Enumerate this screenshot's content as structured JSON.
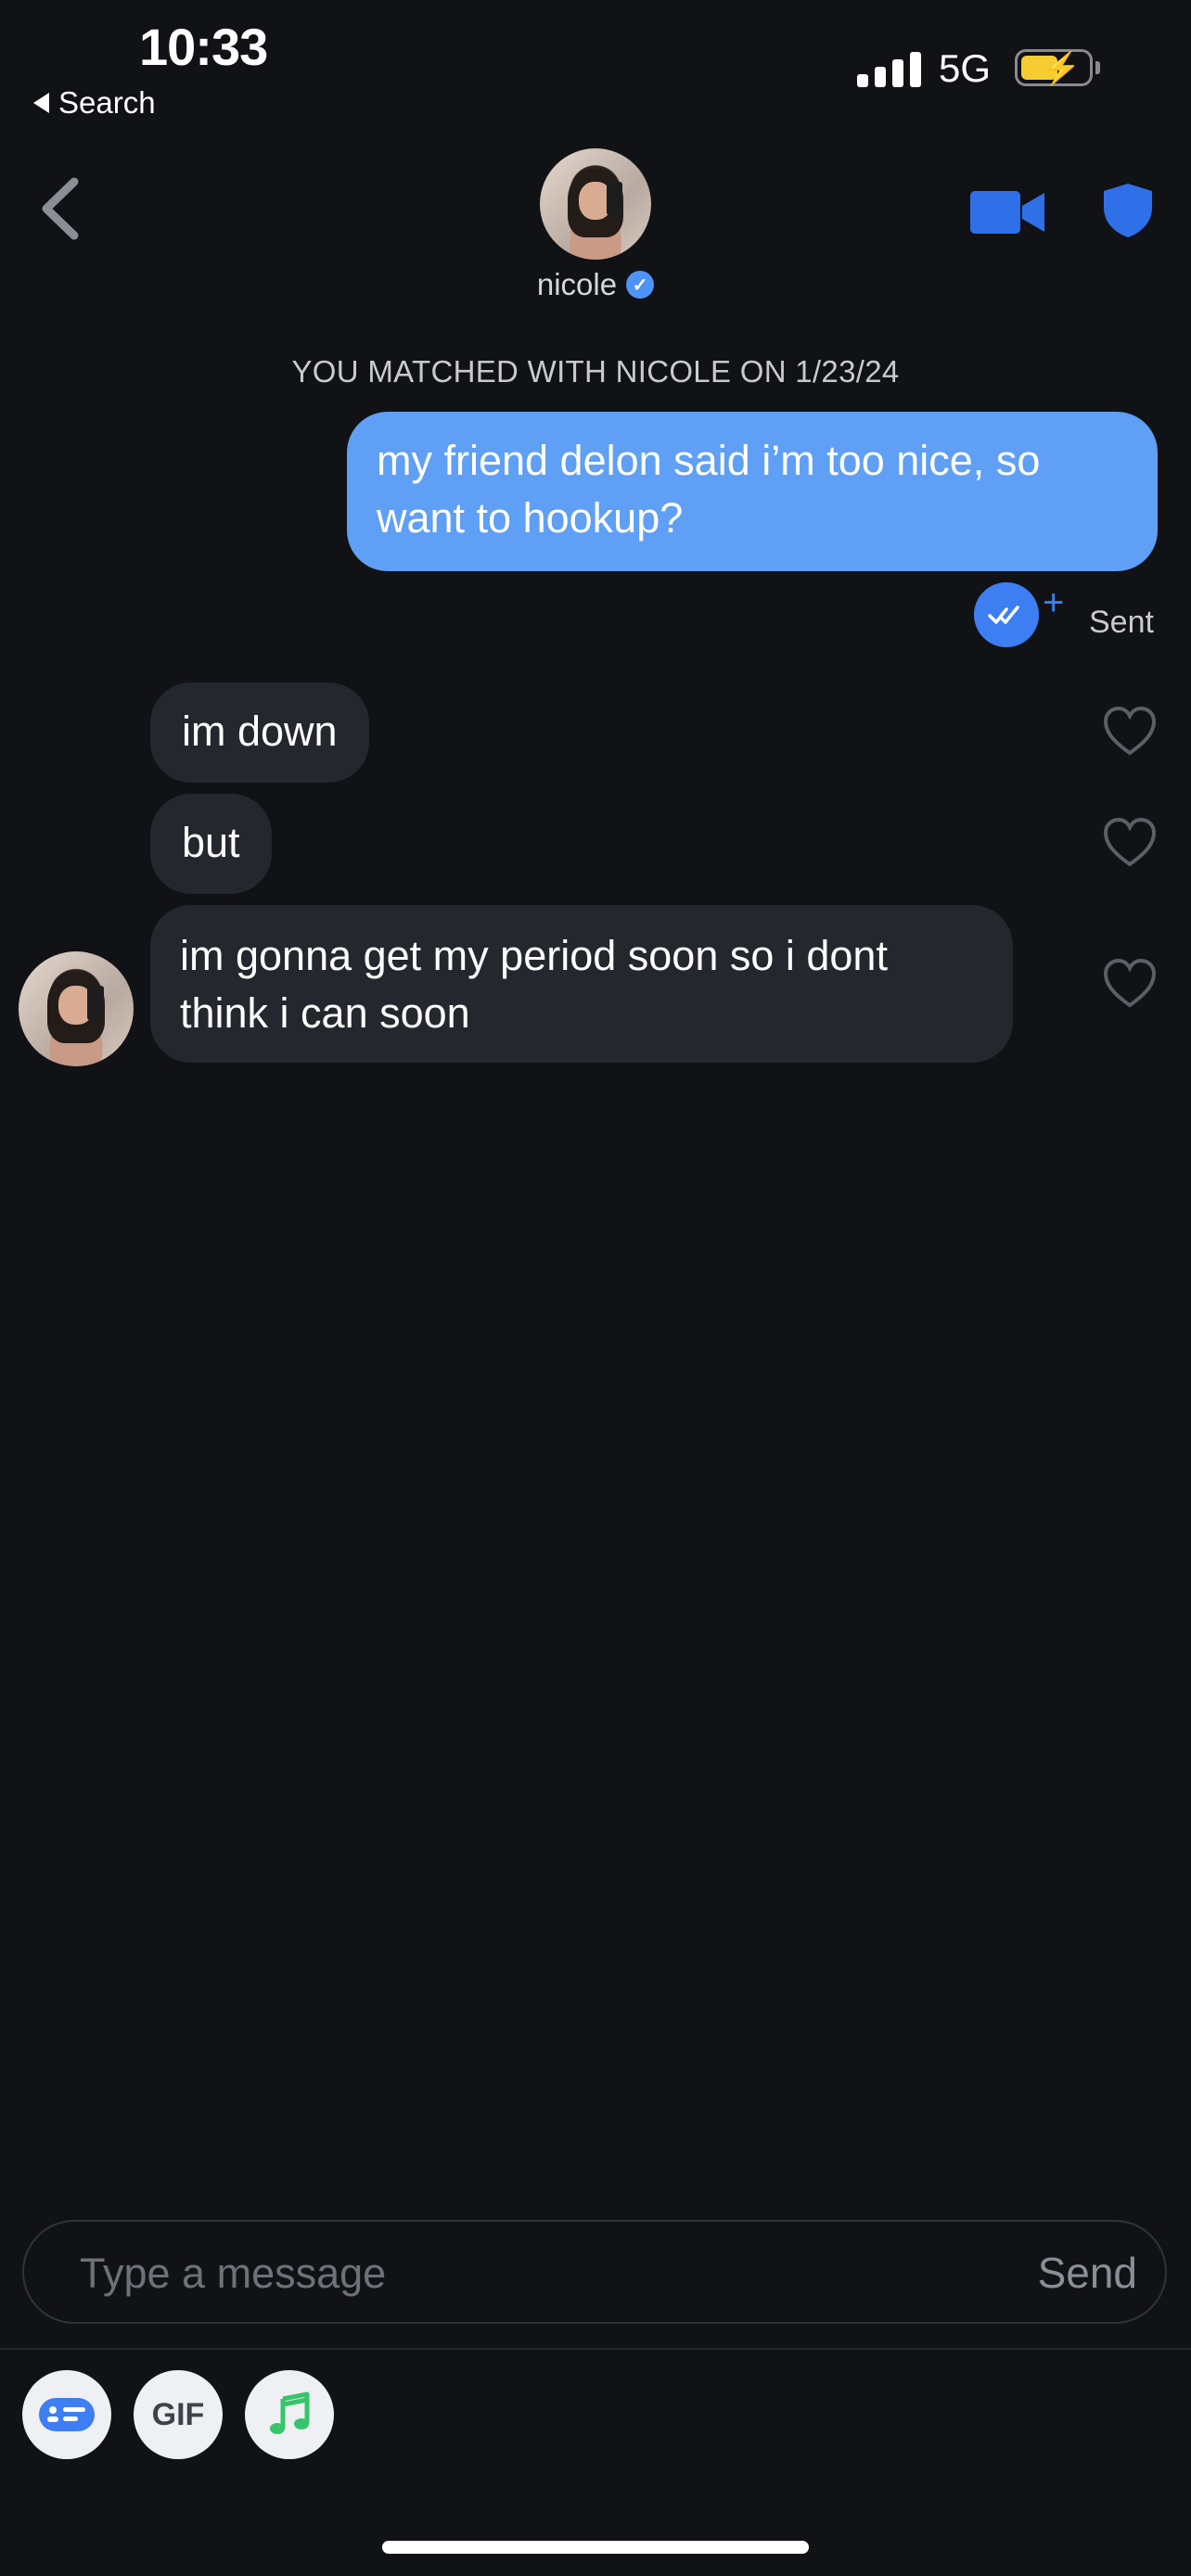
{
  "status_bar": {
    "time": "10:33",
    "back_label": "Search",
    "network": "5G"
  },
  "header": {
    "name": "nicole",
    "verified": true
  },
  "chat": {
    "match_notice": "YOU MATCHED WITH NICOLE ON 1/23/24",
    "outgoing": [
      {
        "text": "my friend delon said i’m too nice, so want to hookup?",
        "status": "Sent"
      }
    ],
    "incoming": [
      {
        "text": "im down"
      },
      {
        "text": "but"
      },
      {
        "text": "im gonna get my period soon so i dont think i can soon"
      }
    ]
  },
  "composer": {
    "placeholder": "Type a message",
    "send_label": "Send",
    "gif_label": "GIF"
  },
  "colors": {
    "background": "#111216",
    "outgoing_bubble": "#5f9ff5",
    "incoming_bubble": "#24272d",
    "accent_blue": "#3d7ef2",
    "battery": "#f5cc32"
  }
}
